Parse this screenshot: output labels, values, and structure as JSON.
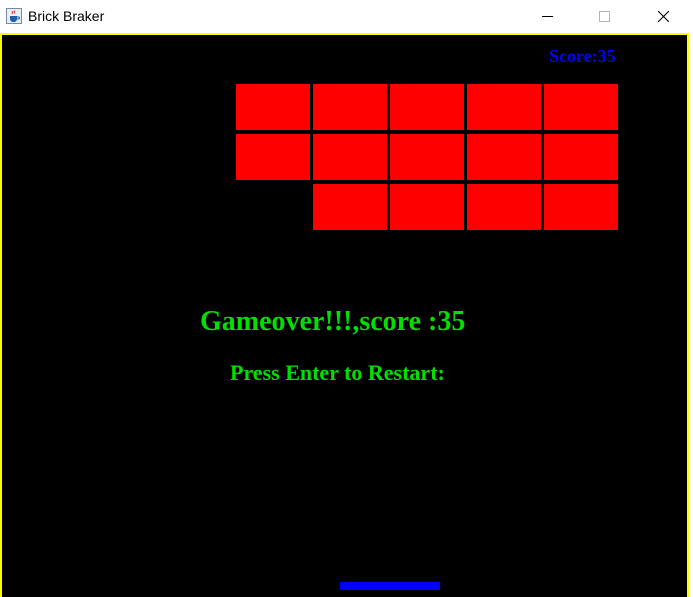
{
  "window": {
    "title": "Brick Braker",
    "icons": {
      "app": "java-cup-icon",
      "minimize": "minimize-icon",
      "maximize": "maximize-icon",
      "close": "close-icon"
    }
  },
  "game": {
    "score_label": "Score:35",
    "gameover_text": "Gameover!!!,score :35",
    "restart_text": "Press Enter to Restart:",
    "brick_grid": {
      "rows": 3,
      "columns": 5,
      "remaining": [
        [
          true,
          true,
          true,
          true,
          true
        ],
        [
          true,
          true,
          true,
          true,
          true
        ],
        [
          false,
          true,
          true,
          true,
          true
        ]
      ]
    },
    "colors": {
      "background": "#000000",
      "border": "#ffff00",
      "brick": "#ff0000",
      "score": "#0000ff",
      "message": "#00e000",
      "paddle": "#0000ff"
    }
  }
}
